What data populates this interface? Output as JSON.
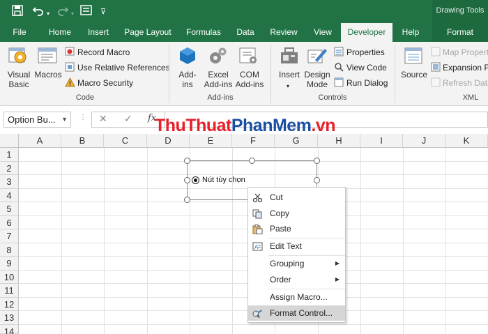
{
  "contextual_tab_group": "Drawing Tools",
  "tabs": [
    "File",
    "Home",
    "Insert",
    "Page Layout",
    "Formulas",
    "Data",
    "Review",
    "View",
    "Developer",
    "Help",
    "Format"
  ],
  "ribbon": {
    "code": {
      "visual_basic": "Visual Basic",
      "macros": "Macros",
      "record_macro": "Record Macro",
      "relative_refs": "Use Relative References",
      "macro_security": "Macro Security",
      "group_label": "Code"
    },
    "addins": {
      "addins": "Add- ins",
      "excel_addins": "Excel Add-ins",
      "com_addins": "COM Add-ins",
      "group_label": "Add-ins"
    },
    "controls": {
      "insert": "Insert",
      "design_mode": "Design Mode",
      "properties": "Properties",
      "view_code": "View Code",
      "run_dialog": "Run Dialog",
      "group_label": "Controls"
    },
    "xml": {
      "source": "Source",
      "map_properties": "Map Propertie",
      "expansion_packs": "Expansion Pa",
      "refresh_data": "Refresh Data",
      "group_label": "XML"
    }
  },
  "formula_bar": {
    "name_box": "Option Bu...",
    "cancel": "✕",
    "enter": "✓",
    "fx": "fx",
    "value": ""
  },
  "columns": [
    "A",
    "B",
    "C",
    "D",
    "E",
    "F",
    "G",
    "H",
    "I",
    "J",
    "K"
  ],
  "rows": [
    "1",
    "2",
    "3",
    "4",
    "5",
    "6",
    "7",
    "8",
    "9",
    "10",
    "11",
    "12",
    "13",
    "14"
  ],
  "watermark": {
    "part1": "ThuThuat",
    "part2": "PhanMem",
    "part3": ".vn"
  },
  "option_button": {
    "label": "Nút tùy chọn",
    "selected": true
  },
  "context_menu": {
    "cut": "Cut",
    "copy": "Copy",
    "paste": "Paste",
    "edit_text": "Edit Text",
    "grouping": "Grouping",
    "order": "Order",
    "assign_macro": "Assign Macro...",
    "format_control": "Format Control..."
  }
}
